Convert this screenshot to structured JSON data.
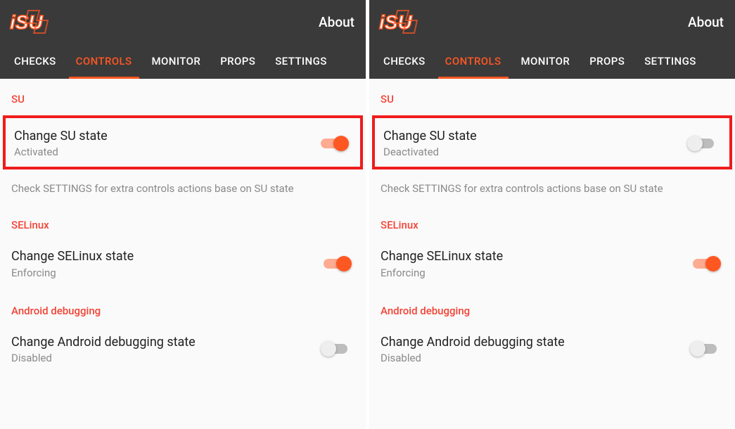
{
  "header": {
    "about": "About",
    "logo_text": "iSU"
  },
  "tabs": {
    "checks": "CHECKS",
    "controls": "CONTROLS",
    "monitor": "MONITOR",
    "props": "PROPS",
    "settings": "SETTINGS"
  },
  "sections": {
    "su": "SU",
    "su_info": "Check SETTINGS for extra controls actions base on SU state",
    "selinux": "SELinux",
    "adb": "Android debugging"
  },
  "left": {
    "su_title": "Change SU state",
    "su_sub": "Activated",
    "su_on": true,
    "selinux_title": "Change SELinux state",
    "selinux_sub": "Enforcing",
    "selinux_on": true,
    "adb_title": "Change Android debugging state",
    "adb_sub": "Disabled",
    "adb_on": false
  },
  "right": {
    "su_title": "Change SU state",
    "su_sub": "Deactivated",
    "su_on": false,
    "selinux_title": "Change SELinux state",
    "selinux_sub": "Enforcing",
    "selinux_on": true,
    "adb_title": "Change Android debugging state",
    "adb_sub": "Disabled",
    "adb_on": false
  },
  "colors": {
    "accent": "#ff5722",
    "danger": "#f44336",
    "header_bg": "#3a3a3a"
  }
}
